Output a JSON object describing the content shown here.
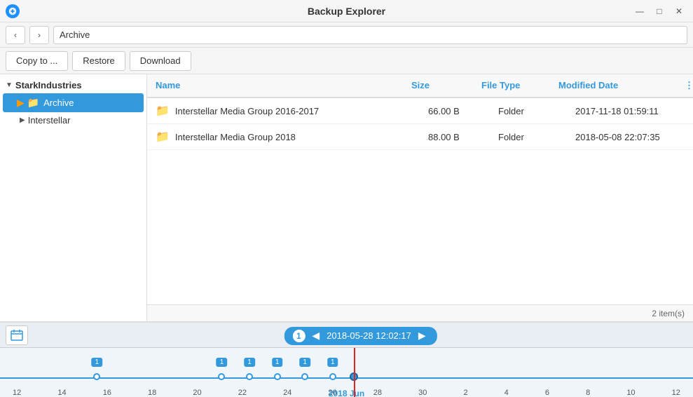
{
  "titlebar": {
    "title": "Backup Explorer",
    "minimize": "—",
    "maximize": "□",
    "close": "✕"
  },
  "navbar": {
    "back": "‹",
    "forward": "›",
    "path": "Archive"
  },
  "toolbar": {
    "copy_label": "Copy to ...",
    "restore_label": "Restore",
    "download_label": "Download"
  },
  "sidebar": {
    "group_label": "StarkIndustries",
    "items": [
      {
        "label": "Archive",
        "selected": true
      },
      {
        "label": "Interstellar",
        "selected": false
      }
    ]
  },
  "file_list": {
    "columns": {
      "name": "Name",
      "size": "Size",
      "file_type": "File Type",
      "modified_date": "Modified Date"
    },
    "rows": [
      {
        "name": "Interstellar Media Group 2016-2017",
        "size": "66.00 B",
        "type": "Folder",
        "date": "2017-11-18 01:59:11"
      },
      {
        "name": "Interstellar Media Group 2018",
        "size": "88.00 B",
        "type": "Folder",
        "date": "2018-05-08 22:07:35"
      }
    ],
    "status": "2 item(s)"
  },
  "timeline": {
    "current_date": "2018-05-28 12:02:17",
    "version_num": "1",
    "bottom_label": "2018 Jun",
    "tick_labels": [
      "12",
      "14",
      "16",
      "18",
      "20",
      "22",
      "24",
      "26",
      "28",
      "30",
      "2",
      "4",
      "6",
      "8",
      "10",
      "12"
    ]
  }
}
